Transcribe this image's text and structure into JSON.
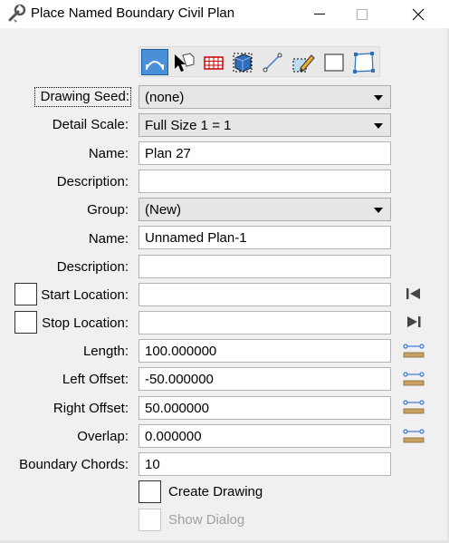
{
  "window": {
    "title": "Place Named Boundary Civil Plan"
  },
  "toolbar": {
    "tools": [
      {
        "name": "civil-plan-tool",
        "active": true
      },
      {
        "name": "select-tool",
        "active": false
      },
      {
        "name": "grid-tool",
        "active": false
      },
      {
        "name": "cube-tool",
        "active": false
      },
      {
        "name": "line-tool",
        "active": false
      },
      {
        "name": "pencil-tool",
        "active": false
      },
      {
        "name": "rectangle-tool",
        "active": false
      },
      {
        "name": "shape-tool",
        "active": false
      }
    ]
  },
  "form": {
    "drawing_seed": {
      "label": "Drawing Seed:",
      "value": "(none)"
    },
    "detail_scale": {
      "label": "Detail Scale:",
      "value": "Full Size 1 = 1"
    },
    "name1": {
      "label": "Name:",
      "value": "Plan 27"
    },
    "description1": {
      "label": "Description:",
      "value": ""
    },
    "group": {
      "label": "Group:",
      "value": "(New)"
    },
    "name2": {
      "label": "Name:",
      "value": "Unnamed Plan-1"
    },
    "description2": {
      "label": "Description:",
      "value": ""
    },
    "start_location": {
      "label": "Start Location:",
      "value": ""
    },
    "stop_location": {
      "label": "Stop Location:",
      "value": ""
    },
    "length": {
      "label": "Length:",
      "value": "100.000000"
    },
    "left_offset": {
      "label": "Left Offset:",
      "value": "-50.000000"
    },
    "right_offset": {
      "label": "Right Offset:",
      "value": "50.000000"
    },
    "overlap": {
      "label": "Overlap:",
      "value": "0.000000"
    },
    "boundary_chords": {
      "label": "Boundary Chords:",
      "value": "10"
    },
    "create_drawing": {
      "label": "Create Drawing",
      "checked": false
    },
    "show_dialog": {
      "label": "Show Dialog",
      "checked": false,
      "enabled": false
    }
  },
  "colors": {
    "accent": "#4a90d9",
    "measure_icon_blue": "#3a7bd5",
    "measure_icon_tan": "#c8a165"
  }
}
